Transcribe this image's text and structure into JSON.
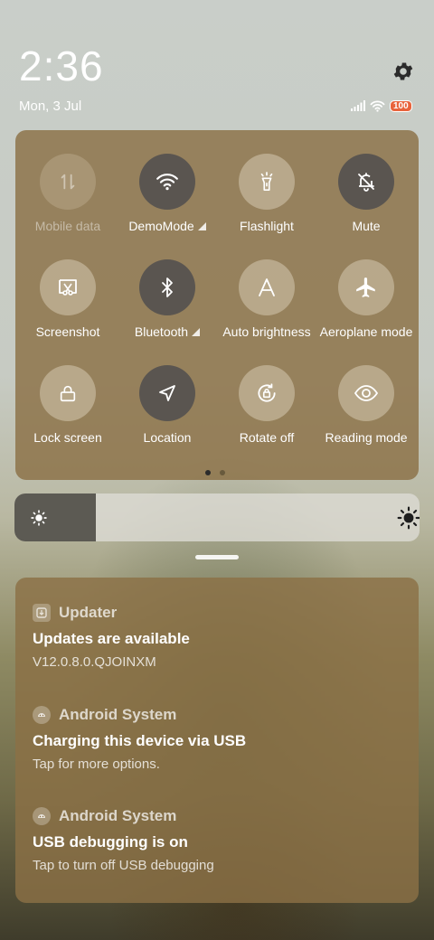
{
  "status_bar": {
    "time": "2:36",
    "date": "Mon, 3 Jul",
    "battery": "100",
    "icons": [
      "signal-icon",
      "wifi-icon",
      "battery-icon"
    ]
  },
  "quick_settings": {
    "tiles": [
      {
        "label": "Mobile data",
        "icon": "mobile-data-icon",
        "state": "disabled"
      },
      {
        "label": "DemoMode",
        "icon": "wifi-icon",
        "state": "on"
      },
      {
        "label": "Flashlight",
        "icon": "flashlight-icon",
        "state": "off"
      },
      {
        "label": "Mute",
        "icon": "bell-off-icon",
        "state": "on"
      },
      {
        "label": "Screenshot",
        "icon": "screenshot-icon",
        "state": "off"
      },
      {
        "label": "Bluetooth",
        "icon": "bluetooth-icon",
        "state": "on"
      },
      {
        "label": "Auto brightness",
        "icon": "auto-brightness-icon",
        "state": "off"
      },
      {
        "label": "Aeroplane mode",
        "icon": "airplane-icon",
        "state": "off"
      },
      {
        "label": "Lock screen",
        "icon": "lock-icon",
        "state": "off"
      },
      {
        "label": "Location",
        "icon": "location-icon",
        "state": "on"
      },
      {
        "label": "Rotate off",
        "icon": "rotate-lock-icon",
        "state": "off"
      },
      {
        "label": "Reading mode",
        "icon": "eye-icon",
        "state": "off"
      }
    ],
    "page_count": 2,
    "current_page": 1
  },
  "brightness": {
    "level": 0.2
  },
  "notifications": [
    {
      "app": "Updater",
      "title": "Updates are available",
      "body": "V12.0.8.0.QJOINXM",
      "icon": "updater-icon"
    },
    {
      "app": "Android System",
      "title": "Charging this device via USB",
      "body": "Tap for more options.",
      "icon": "android-icon"
    },
    {
      "app": "Android System",
      "title": "USB debugging is on",
      "body": "Tap to turn off USB debugging",
      "icon": "android-icon"
    }
  ],
  "colors": {
    "panel": "#8b7046",
    "tile_on": "#5a5550",
    "battery": "#e8643c"
  }
}
